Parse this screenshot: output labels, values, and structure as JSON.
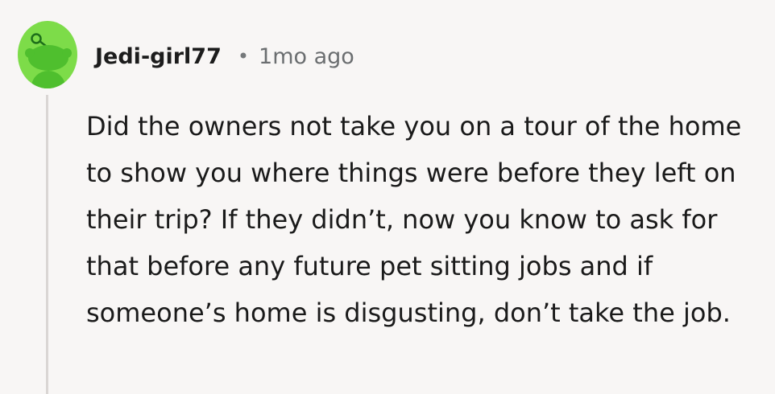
{
  "comment": {
    "avatar_icon": "snoo-avatar-icon",
    "avatar_color": "#7ddc49",
    "username": "Jedi-girl77",
    "separator": "•",
    "timestamp": "1mo ago",
    "body": "Did the owners not take you on a tour of the home to show you where things were before they left on their trip? If they didn’t, now you know to ask for that before any future pet sitting jobs and if someone’s home is disgusting, don’t take the job."
  }
}
